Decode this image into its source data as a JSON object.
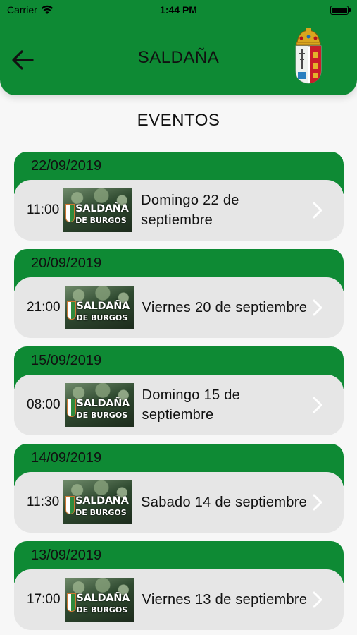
{
  "status_bar": {
    "carrier": "Carrier",
    "time": "1:44 PM"
  },
  "header": {
    "title": "SALDAÑA"
  },
  "section": {
    "title": "EVENTOS"
  },
  "thumbnail": {
    "line1": "SALDAÑA",
    "line2": "DE BURGOS"
  },
  "colors": {
    "brand_green": "#0e8a34",
    "card_gray": "#e6e6e6",
    "background": "#f7f7f7"
  },
  "events": [
    {
      "date": "22/09/2019",
      "time": "11:00",
      "name": "Domingo 22 de septiembre"
    },
    {
      "date": "20/09/2019",
      "time": "21:00",
      "name": "Viernes 20 de septiembre"
    },
    {
      "date": "15/09/2019",
      "time": "08:00",
      "name": "Domingo 15 de septiembre"
    },
    {
      "date": "14/09/2019",
      "time": "11:30",
      "name": "Sabado 14 de septiembre"
    },
    {
      "date": "13/09/2019",
      "time": "17:00",
      "name": "Viernes 13 de septiembre"
    }
  ]
}
